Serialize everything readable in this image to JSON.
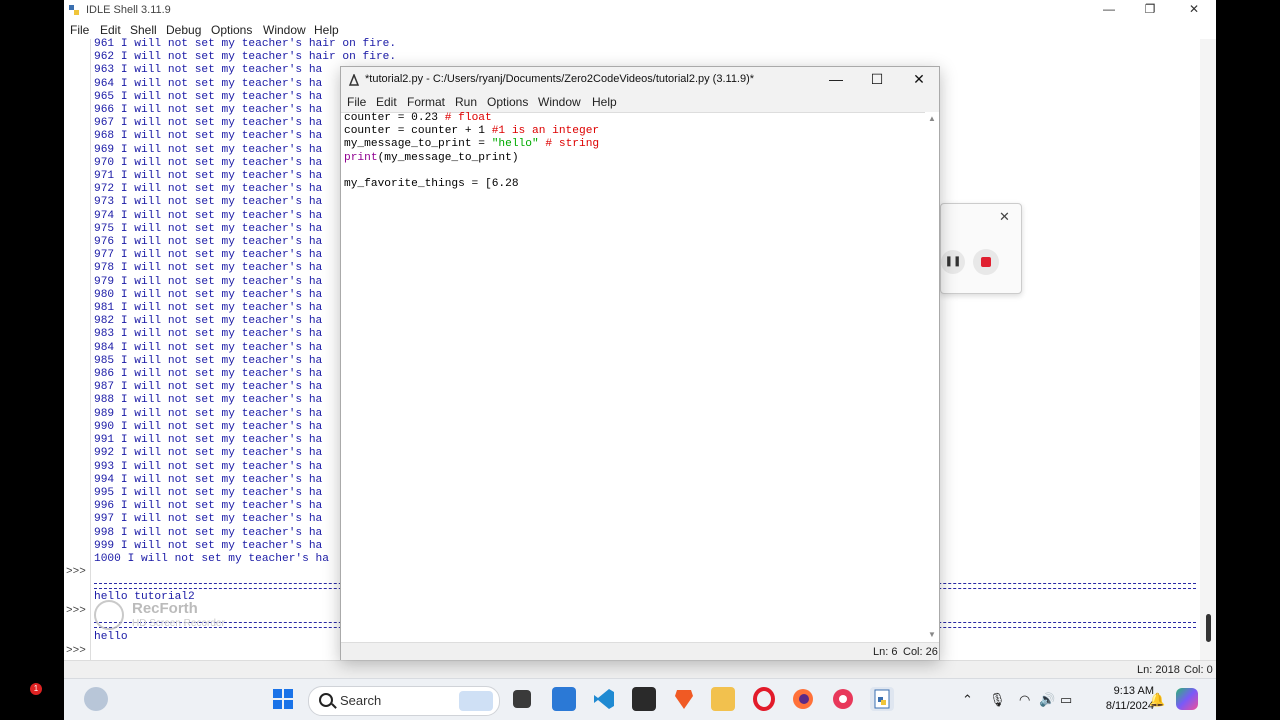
{
  "shell": {
    "title": "IDLE Shell 3.11.9",
    "menu": [
      "File",
      "Edit",
      "Shell",
      "Debug",
      "Options",
      "Window",
      "Help"
    ],
    "lines": [
      "961 I will not set my teacher's hair on fire.",
      "962 I will not set my teacher's hair on fire.",
      "963 I will not set my teacher's ha",
      "964 I will not set my teacher's ha",
      "965 I will not set my teacher's ha",
      "966 I will not set my teacher's ha",
      "967 I will not set my teacher's ha",
      "968 I will not set my teacher's ha",
      "969 I will not set my teacher's ha",
      "970 I will not set my teacher's ha",
      "971 I will not set my teacher's ha",
      "972 I will not set my teacher's ha",
      "973 I will not set my teacher's ha",
      "974 I will not set my teacher's ha",
      "975 I will not set my teacher's ha",
      "976 I will not set my teacher's ha",
      "977 I will not set my teacher's ha",
      "978 I will not set my teacher's ha",
      "979 I will not set my teacher's ha",
      "980 I will not set my teacher's ha",
      "981 I will not set my teacher's ha",
      "982 I will not set my teacher's ha",
      "983 I will not set my teacher's ha",
      "984 I will not set my teacher's ha",
      "985 I will not set my teacher's ha",
      "986 I will not set my teacher's ha",
      "987 I will not set my teacher's ha",
      "988 I will not set my teacher's ha",
      "989 I will not set my teacher's ha",
      "990 I will not set my teacher's ha",
      "991 I will not set my teacher's ha",
      "992 I will not set my teacher's ha",
      "993 I will not set my teacher's ha",
      "994 I will not set my teacher's ha",
      "995 I will not set my teacher's ha",
      "996 I will not set my teacher's ha",
      "997 I will not set my teacher's ha",
      "998 I will not set my teacher's ha",
      "999 I will not set my teacher's ha",
      "1000 I will not set my teacher's ha"
    ],
    "prompt": ">>>",
    "output_1": "hello tutorial2",
    "output_2": "hello",
    "status_ln": "Ln: 2018",
    "status_col": "Col: 0"
  },
  "watermark": {
    "brand": "RecForth",
    "sub": "HD Screen Recorder"
  },
  "editor": {
    "title": "*tutorial2.py - C:/Users/ryanj/Documents/Zero2CodeVideos/tutorial2.py (3.11.9)*",
    "menu": [
      "File",
      "Edit",
      "Format",
      "Run",
      "Options",
      "Window",
      "Help"
    ],
    "code": {
      "l1_a": "counter = 0.23 ",
      "l1_c": "# float",
      "l2_a": "counter = counter + 1 ",
      "l2_c": "#1 is an integer",
      "l3_a": "my_message_to_print = ",
      "l3_s": "\"hello\"",
      "l3_b": " ",
      "l3_c": "# string",
      "l4_f": "print",
      "l4_a": "(my_message_to_print)",
      "l6_a": "my_favorite_things = [6.28"
    },
    "status_ln": "Ln: 6",
    "status_col": "Col: 26"
  },
  "taskbar": {
    "search_label": "Search",
    "notification_count": "1",
    "time": "9:13 AM",
    "date": "8/11/2024",
    "icons": [
      "weather-icon",
      "start-icon",
      "search-icon",
      "task-view-icon",
      "store-icon",
      "vscode-icon",
      "terminal-icon",
      "brave-icon",
      "file-explorer-icon",
      "opera-icon",
      "firefox-icon",
      "recorder-icon",
      "idle-icon"
    ]
  },
  "colors": {
    "shell_text": "#1a1aa6",
    "comment": "#dd0000",
    "string": "#00aa00",
    "builtin": "#900090"
  }
}
